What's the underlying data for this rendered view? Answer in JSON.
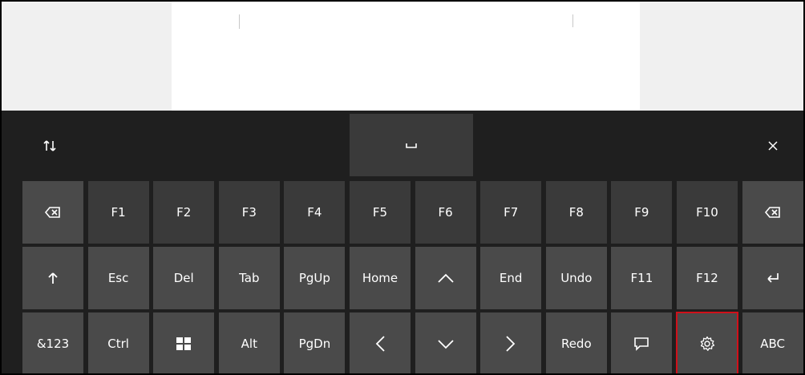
{
  "colors": {
    "keyboard_bg": "#1f1f1f",
    "key_dark": "#3a3a3a",
    "key_light": "#4a4a4a",
    "text": "#ffffff",
    "highlight": "#d0101a",
    "doc_bg": "#f0f0f0",
    "doc_page": "#ffffff"
  },
  "toolbar": {
    "dock_icon": "up-down-arrows-icon",
    "space_icon": "space-bar-icon",
    "close_icon": "close-icon"
  },
  "rows": [
    [
      {
        "name": "backspace-left-key",
        "icon": "backspace-icon"
      },
      {
        "name": "f1-key",
        "label": "F1"
      },
      {
        "name": "f2-key",
        "label": "F2"
      },
      {
        "name": "f3-key",
        "label": "F3"
      },
      {
        "name": "f4-key",
        "label": "F4"
      },
      {
        "name": "f5-key",
        "label": "F5"
      },
      {
        "name": "f6-key",
        "label": "F6"
      },
      {
        "name": "f7-key",
        "label": "F7"
      },
      {
        "name": "f8-key",
        "label": "F8"
      },
      {
        "name": "f9-key",
        "label": "F9"
      },
      {
        "name": "f10-key",
        "label": "F10"
      },
      {
        "name": "backspace-right-key",
        "icon": "backspace-icon"
      }
    ],
    [
      {
        "name": "shift-key",
        "icon": "shift-arrow-icon"
      },
      {
        "name": "esc-key",
        "label": "Esc"
      },
      {
        "name": "del-key",
        "label": "Del"
      },
      {
        "name": "tab-key",
        "label": "Tab"
      },
      {
        "name": "pgup-key",
        "label": "PgUp"
      },
      {
        "name": "home-key",
        "label": "Home"
      },
      {
        "name": "up-arrow-key",
        "icon": "chevron-up-icon"
      },
      {
        "name": "end-key",
        "label": "End"
      },
      {
        "name": "undo-key",
        "label": "Undo"
      },
      {
        "name": "f11-key",
        "label": "F11"
      },
      {
        "name": "f12-key",
        "label": "F12"
      },
      {
        "name": "enter-key",
        "icon": "enter-icon"
      }
    ],
    [
      {
        "name": "symbols-key",
        "label": "&123"
      },
      {
        "name": "ctrl-key",
        "label": "Ctrl"
      },
      {
        "name": "windows-key",
        "icon": "windows-logo-icon"
      },
      {
        "name": "alt-key",
        "label": "Alt"
      },
      {
        "name": "pgdn-key",
        "label": "PgDn"
      },
      {
        "name": "left-arrow-key",
        "icon": "chevron-left-icon"
      },
      {
        "name": "down-arrow-key",
        "icon": "chevron-down-icon"
      },
      {
        "name": "right-arrow-key",
        "icon": "chevron-right-icon"
      },
      {
        "name": "redo-key",
        "label": "Redo"
      },
      {
        "name": "emoji-key",
        "icon": "speech-bubble-icon"
      },
      {
        "name": "settings-key",
        "icon": "gear-icon"
      },
      {
        "name": "abc-key",
        "label": "ABC"
      }
    ]
  ]
}
